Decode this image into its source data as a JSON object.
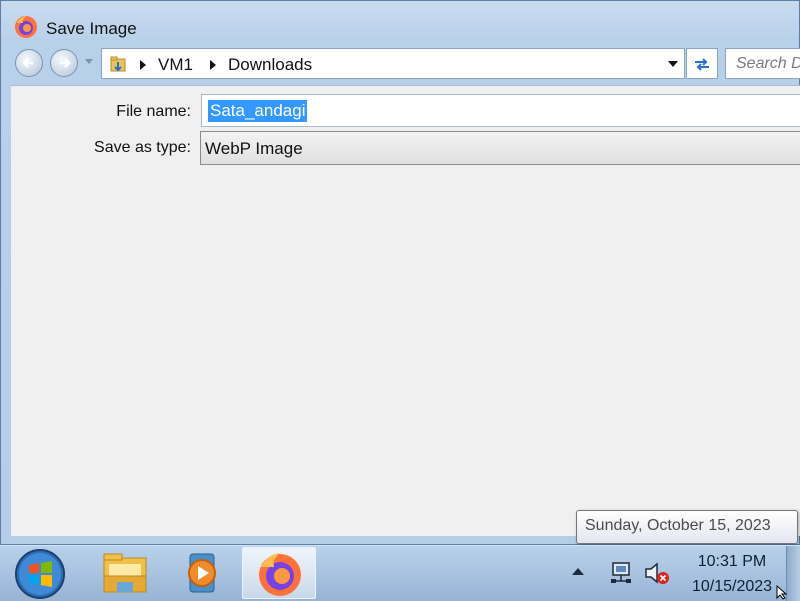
{
  "dialog": {
    "title": "Save Image",
    "app_icon": "firefox-icon"
  },
  "navigation": {
    "back_icon": "back-arrow-icon",
    "forward_icon": "forward-arrow-icon",
    "breadcrumbs": [
      "VM1",
      "Downloads"
    ],
    "refresh_icon": "refresh-icon",
    "search_placeholder": "Search D"
  },
  "form": {
    "file_name_label": "File name:",
    "file_name_value": "Sata_andagi",
    "save_as_type_label": "Save as type:",
    "save_as_type_value": "WebP Image"
  },
  "tooltip": {
    "text": "Sunday, October 15, 2023"
  },
  "taskbar": {
    "apps": [
      "windows-explorer-icon",
      "media-player-icon",
      "firefox-icon"
    ],
    "active_app": "firefox-icon",
    "clock_time": "10:31 PM",
    "clock_date": "10/15/2023"
  },
  "colors": {
    "selection": "#3399ff",
    "window_frame": "#b9d0ea",
    "dialog_body": "#f0f0f0",
    "taskbar": "#a9c3e0"
  }
}
